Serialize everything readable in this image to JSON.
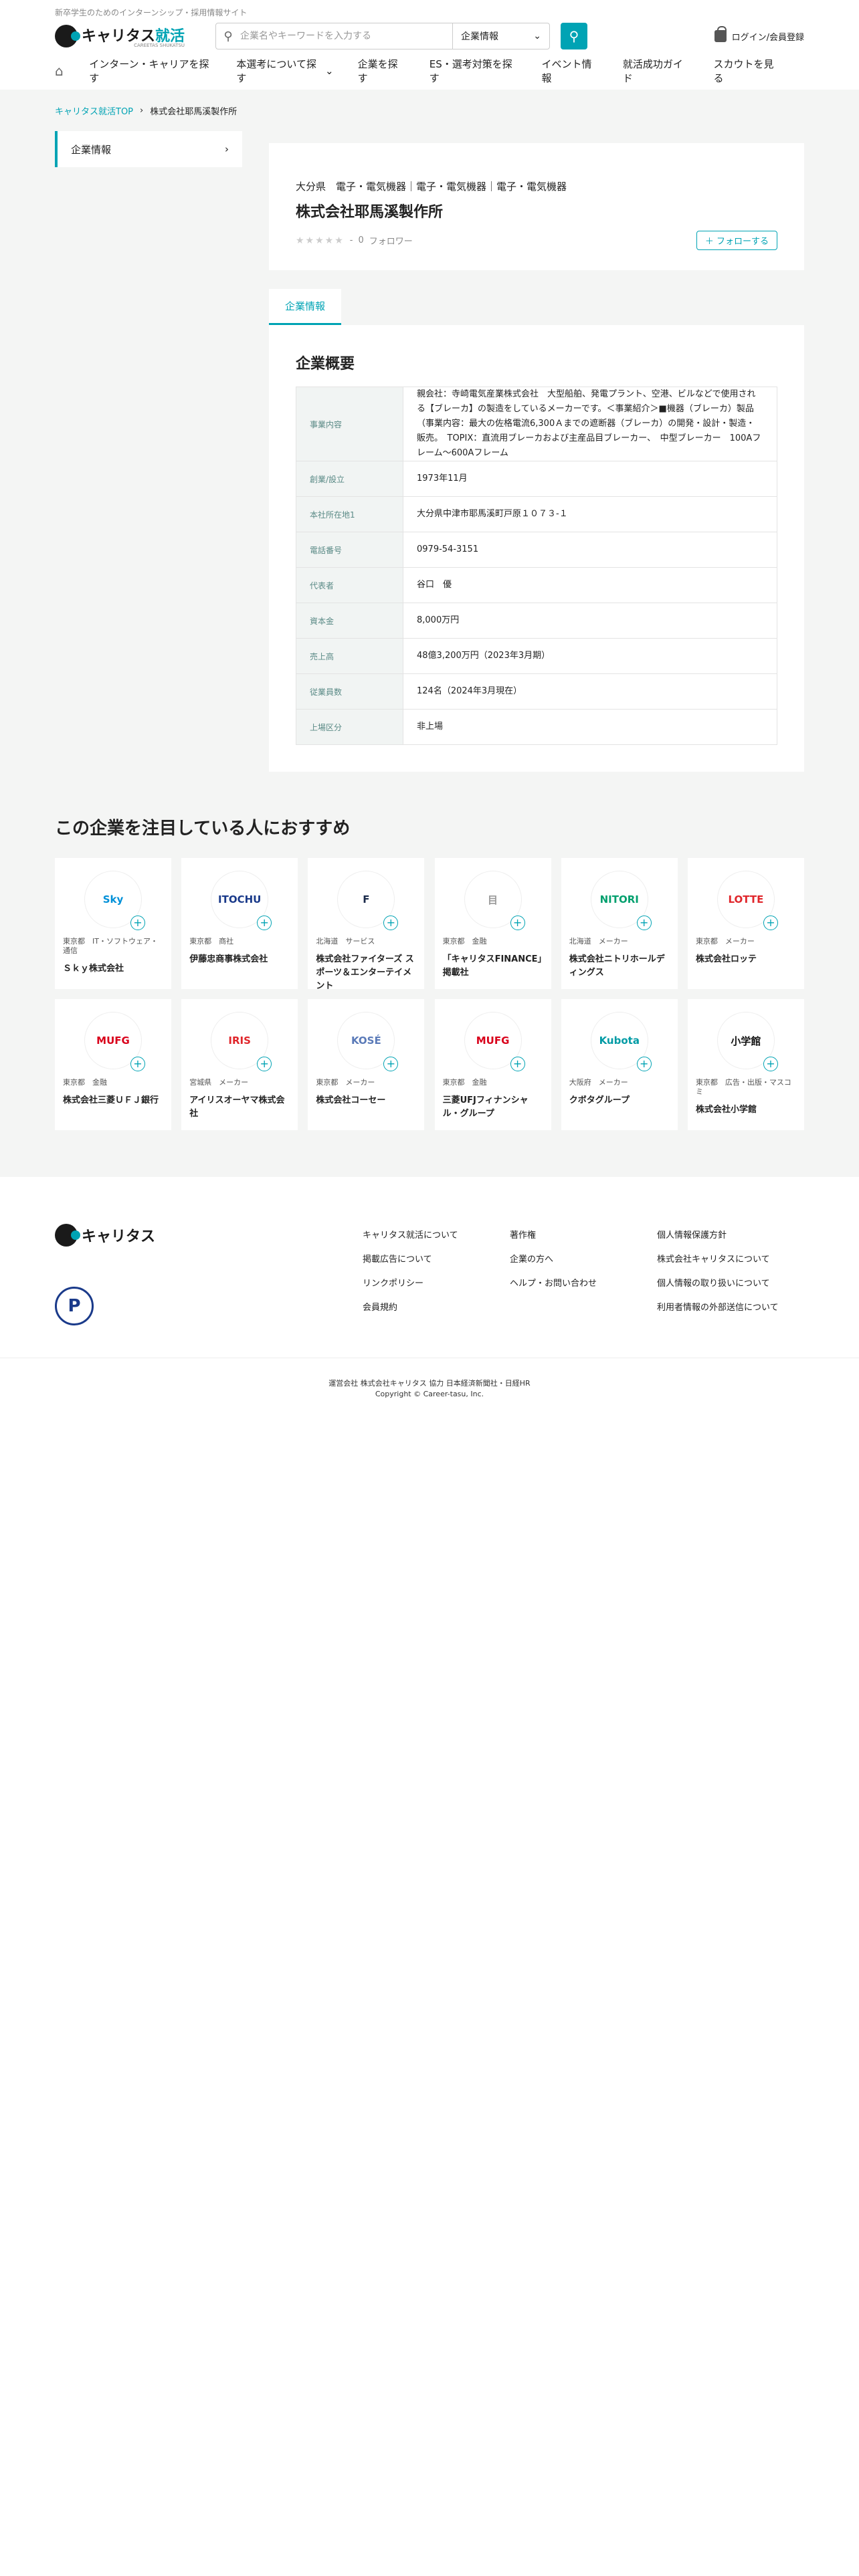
{
  "header": {
    "tagline": "新卒学生のためのインターンシップ・採用情報サイト",
    "logo_main": "キャリタス",
    "logo_accent": "就活",
    "logo_sub": "CAREETAS SHUKATSU",
    "search_placeholder": "企業名やキーワードを入力する",
    "search_select": "企業情報",
    "login": "ログイン/会員登録"
  },
  "nav": [
    "インターン・キャリアを探す",
    "本選考について探す",
    "企業を探す",
    "ES・選考対策を探す",
    "イベント情報",
    "就活成功ガイド",
    "スカウトを見る"
  ],
  "breadcrumb": [
    "キャリタス就活TOP",
    "株式会社耶馬溪製作所"
  ],
  "sidebar": {
    "item": "企業情報"
  },
  "company": {
    "category": "大分県　電子・電気機器｜電子・電気機器｜電子・電気機器",
    "name": "株式会社耶馬溪製作所",
    "rating": "-",
    "followers": "0",
    "followers_label": "フォロワー",
    "follow_btn": "＋ フォローする"
  },
  "tab": "企業情報",
  "overview": {
    "title": "企業概要",
    "rows": [
      {
        "k": "事業内容",
        "v": "親会社：寺崎電気産業株式会社　大型船舶、発電プラント、空港、ビルなどで使用される【ブレーカ】の製造をしているメーカーです。＜事業紹介＞■機器（ブレーカ）製品（事業内容：最大の佐格電流6,300Ａまでの遮断器（ブレーカ）の開発・設計・製造・販売。　TOPIX：直流用ブレーカおよび主産品目ブレーカー、　中型ブレーカー　100Aフレーム〜600Aフレーム"
      },
      {
        "k": "創業/設立",
        "v": "1973年11月"
      },
      {
        "k": "本社所在地1",
        "v": "大分県中津市耶馬溪町戸原１０７３-１"
      },
      {
        "k": "電話番号",
        "v": "0979-54-3151"
      },
      {
        "k": "代表者",
        "v": "谷口　優"
      },
      {
        "k": "資本金",
        "v": "8,000万円"
      },
      {
        "k": "売上高",
        "v": "48億3,200万円（2023年3月期）"
      },
      {
        "k": "従業員数",
        "v": "124名（2024年3月現在）"
      },
      {
        "k": "上場区分",
        "v": "非上場"
      }
    ]
  },
  "recommend": {
    "title": "この企業を注目している人におすすめ",
    "cards": [
      {
        "logo": "Sky",
        "meta": "東京都　IT・ソフトウェア・通信",
        "name": "Ｓｋｙ株式会社",
        "color": "#0090d8"
      },
      {
        "logo": "ITOCHU",
        "meta": "東京都　商社",
        "name": "伊藤忠商事株式会社",
        "color": "#1a3a8a"
      },
      {
        "logo": "F",
        "meta": "北海道　サービス",
        "name": "株式会社ファイターズ スポーツ＆エンターテイメント",
        "color": "#1a2a4a"
      },
      {
        "logo": "目",
        "meta": "東京都　金融",
        "name": "「キャリタスFINANCE」掲載社",
        "color": "#999999"
      },
      {
        "logo": "NITORI",
        "meta": "北海道　メーカー",
        "name": "株式会社ニトリホールディングス",
        "color": "#00a06e"
      },
      {
        "logo": "LOTTE",
        "meta": "東京都　メーカー",
        "name": "株式会社ロッテ",
        "color": "#e0262b"
      },
      {
        "logo": "MUFG",
        "meta": "東京都　金融",
        "name": "株式会社三菱ＵＦＪ銀行",
        "color": "#d9001b"
      },
      {
        "logo": "IRIS",
        "meta": "宮城県　メーカー",
        "name": "アイリスオーヤマ株式会社",
        "color": "#e0262b"
      },
      {
        "logo": "KOSÉ",
        "meta": "東京都　メーカー",
        "name": "株式会社コーセー",
        "color": "#5a7ab8"
      },
      {
        "logo": "MUFG",
        "meta": "東京都　金融",
        "name": "三菱UFJフィナンシャル・グループ",
        "color": "#d9001b"
      },
      {
        "logo": "Kubota",
        "meta": "大阪府　メーカー",
        "name": "クボタグループ",
        "color": "#009ba5"
      },
      {
        "logo": "小学館",
        "meta": "東京都　広告・出版・マスコミ",
        "name": "株式会社小学館",
        "color": "#111111"
      }
    ]
  },
  "footer": {
    "logo": "キャリタス",
    "pmark": "P",
    "cols": [
      [
        "キャリタス就活について",
        "掲載広告について",
        "リンクポリシー",
        "会員規約"
      ],
      [
        "著作権",
        "企業の方へ",
        "ヘルプ・お問い合わせ"
      ],
      [
        "個人情報保護方針",
        "株式会社キャリタスについて",
        "個人情報の取り扱いについて",
        "利用者情報の外部送信について"
      ]
    ],
    "operator": "運営会社 株式会社キャリタス 協力 日本経済新聞社・日経HR",
    "copyright": "Copyright © Career-tasu, Inc."
  }
}
